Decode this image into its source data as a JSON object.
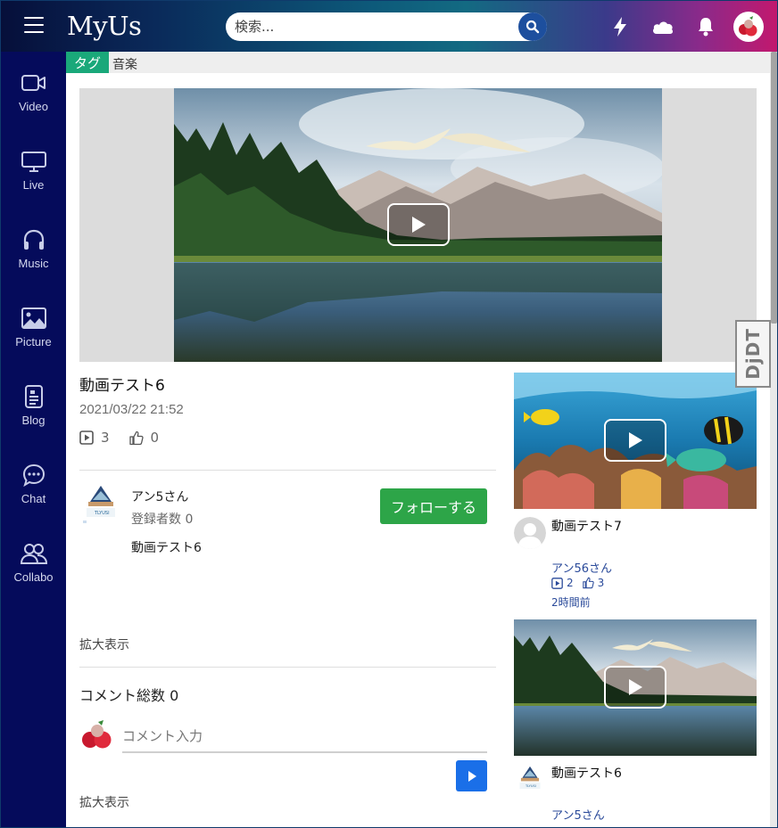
{
  "app": {
    "logo_text": "MyUs"
  },
  "header": {
    "search_placeholder": "検索...",
    "icons": [
      "menu-icon",
      "search-icon",
      "lightning-icon",
      "cloud-icon",
      "bell-icon",
      "avatar"
    ]
  },
  "sidebar": {
    "items": [
      {
        "label": "Video",
        "icon": "video-camera-icon"
      },
      {
        "label": "Live",
        "icon": "monitor-icon"
      },
      {
        "label": "Music",
        "icon": "headphones-icon"
      },
      {
        "label": "Picture",
        "icon": "image-icon"
      },
      {
        "label": "Blog",
        "icon": "document-icon"
      },
      {
        "label": "Chat",
        "icon": "chat-icon"
      },
      {
        "label": "Collabo",
        "icon": "users-icon"
      }
    ]
  },
  "tagbar": {
    "badge": "タグ",
    "value": "音楽"
  },
  "video": {
    "title": "動画テスト6",
    "date": "2021/03/22 21:52",
    "views": "3",
    "likes": "0"
  },
  "channel": {
    "name": "アン5さん",
    "subscribers": "登録者数 0",
    "description": "動画テスト6",
    "follow_label": "フォローする"
  },
  "expand_label": "拡大表示",
  "comments": {
    "count_label": "コメント総数 0",
    "input_placeholder": "コメント入力"
  },
  "recommended": [
    {
      "title": "動画テスト7",
      "channel": "アン56さん",
      "views": "2",
      "likes": "3",
      "time": "2時間前"
    },
    {
      "title": "動画テスト6",
      "channel": "アン5さん"
    }
  ],
  "overlay_badge": "DjDT",
  "colors": {
    "sidebar": "#050b5b",
    "tag_badge": "#1aa87a",
    "follow_button": "#2da548",
    "send_button": "#1a6fe8",
    "link": "#2a4a9a"
  }
}
